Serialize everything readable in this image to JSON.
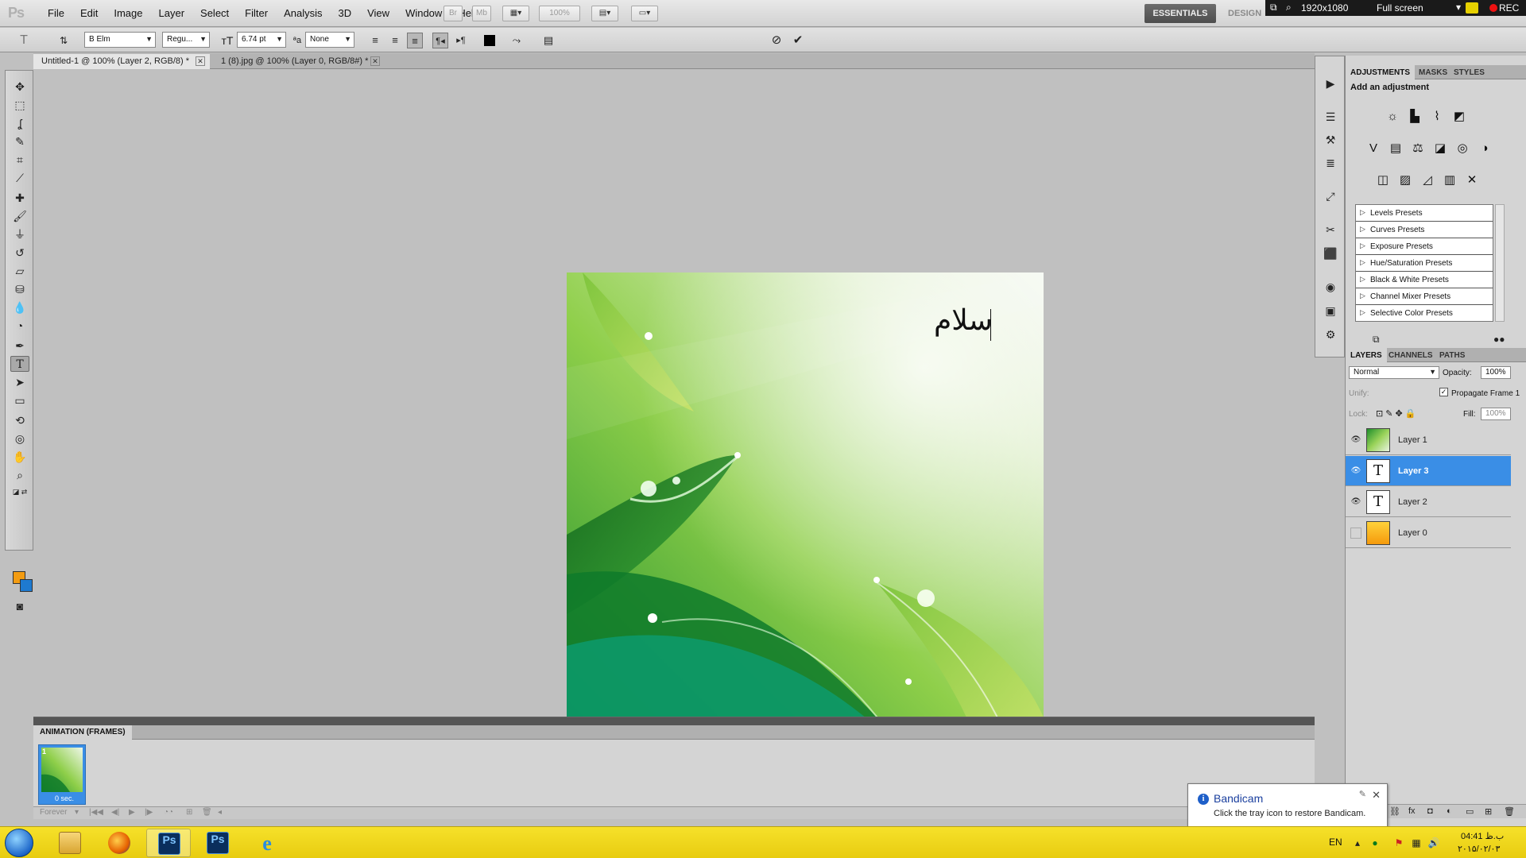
{
  "app": {
    "logo": "Ps",
    "menu": [
      "File",
      "Edit",
      "Image",
      "Layer",
      "Select",
      "Filter",
      "Analysis",
      "3D",
      "View",
      "Window",
      "Help"
    ],
    "zoom": "100%",
    "workspace_active": "ESSENTIALS",
    "workspace_other": "DESIGN"
  },
  "bandicam_bar": {
    "resolution": "1920x1080",
    "mode": "Full screen",
    "rec": "REC"
  },
  "options": {
    "font_family": "B Elm",
    "font_style": "Regu...",
    "font_size": "6.74 pt",
    "antialias": "None",
    "text_color": "#000000"
  },
  "doc_tabs": [
    {
      "label": "Untitled-1 @ 100% (Layer 2, RGB/8) *",
      "active": true
    },
    {
      "label": "1 (8).jpg @ 100% (Layer 0, RGB/8#) *",
      "active": false
    }
  ],
  "canvas": {
    "text": "سلام"
  },
  "toolbox": {
    "foreground_color": "#f39c12",
    "background_color": "#1e7ad0"
  },
  "adjustments": {
    "tabs": [
      "ADJUSTMENTS",
      "MASKS",
      "STYLES"
    ],
    "title": "Add an adjustment",
    "presets": [
      "Levels Presets",
      "Curves Presets",
      "Exposure Presets",
      "Hue/Saturation Presets",
      "Black & White Presets",
      "Channel Mixer Presets",
      "Selective Color Presets"
    ]
  },
  "layers": {
    "tabs": [
      "LAYERS",
      "CHANNELS",
      "PATHS"
    ],
    "blend_mode": "Normal",
    "opacity_label": "Opacity:",
    "opacity": "100%",
    "unify_label": "Unify:",
    "propagate_label": "Propagate Frame 1",
    "lock_label": "Lock:",
    "fill_label": "Fill:",
    "fill": "100%",
    "items": [
      {
        "name": "Layer 1",
        "visible": true,
        "kind": "image",
        "selected": false
      },
      {
        "name": "Layer 3",
        "visible": true,
        "kind": "text",
        "selected": true
      },
      {
        "name": "Layer 2",
        "visible": true,
        "kind": "text",
        "selected": false
      },
      {
        "name": "Layer 0",
        "visible": false,
        "kind": "gradient",
        "selected": false
      }
    ]
  },
  "animation": {
    "title": "ANIMATION (FRAMES)",
    "frame_number": "1",
    "frame_delay": "0 sec.",
    "loop": "Forever"
  },
  "notification": {
    "title": "Bandicam",
    "body": "Click the tray icon to restore Bandicam."
  },
  "taskbar": {
    "language": "EN",
    "time": "04:41 ب.ظ",
    "date": "۲۰۱۵/۰۲/۰۳"
  }
}
